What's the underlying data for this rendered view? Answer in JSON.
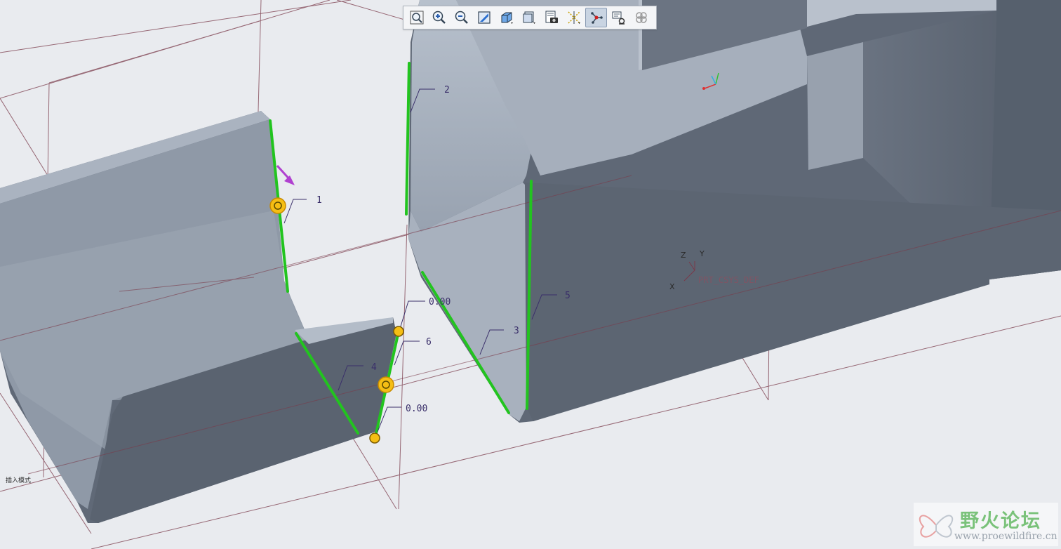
{
  "toolbar": {
    "buttons": [
      {
        "icon": "zoom-fit-icon",
        "active": false
      },
      {
        "icon": "zoom-in-icon",
        "active": false
      },
      {
        "icon": "zoom-out-icon",
        "active": false
      },
      {
        "icon": "repaint-icon",
        "active": false
      },
      {
        "icon": "display-style-icon",
        "active": false
      },
      {
        "icon": "saved-orientations-icon",
        "active": false
      },
      {
        "icon": "view-manager-icon",
        "active": false
      },
      {
        "icon": "datum-display-icon",
        "active": false
      },
      {
        "icon": "edge-select-icon",
        "active": true
      },
      {
        "icon": "annotation-display-icon",
        "active": false
      },
      {
        "icon": "spin-center-icon",
        "active": false
      }
    ]
  },
  "dimensions": {
    "d1": "1",
    "d2": "2",
    "d3": "3",
    "d4": "4",
    "d5": "5",
    "d6": "6",
    "dim_top": "0.00",
    "dim_bottom": "0.00"
  },
  "csys": {
    "label": "PRT_CSYS_DEF",
    "x": "X",
    "y": "Y",
    "z": "Z"
  },
  "status_text": "插入模式",
  "watermark": {
    "title": "野火论坛",
    "url": "www.proewildfire.cn"
  },
  "colors": {
    "background": "#e9ebef",
    "part_light": "#a4adba",
    "part_dark": "#5f6876",
    "highlight": "#22c41f",
    "datum": "#7a3a4a",
    "handle": "#f5be14"
  }
}
